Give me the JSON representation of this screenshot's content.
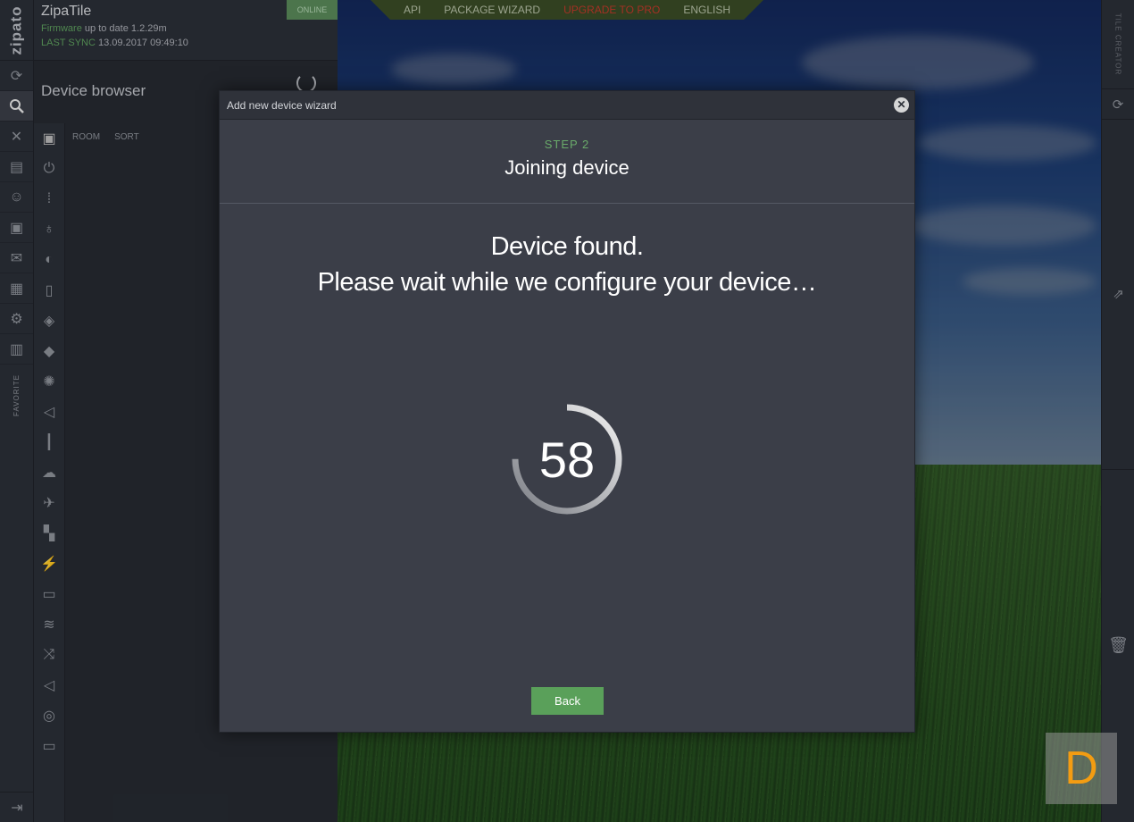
{
  "app": {
    "logo": "zipato",
    "title": "ZipaTile",
    "firmware_label": "Firmware",
    "firmware_text": "up to date 1.2.29m",
    "sync_label": "LAST SYNC",
    "sync_time": "13.09.2017 09:49:10",
    "status": "ONLINE"
  },
  "topnav": {
    "api": "API",
    "package_wizard": "PACKAGE WIZARD",
    "upgrade": "UPGRADE TO PRO",
    "language": "ENGLISH"
  },
  "browser": {
    "title": "Device browser",
    "room": "ROOM",
    "sort": "SORT"
  },
  "rail": {
    "favorite": "FAVORITE"
  },
  "right_rail": {
    "label": "TILE CREATOR"
  },
  "modal": {
    "title": "Add new device wizard",
    "close_glyph": "✕",
    "step_label": "STEP 2",
    "step_title": "Joining device",
    "message_line1": "Device found.",
    "message_line2": "Please wait while we configure your device…",
    "countdown": "58",
    "countdown_progress": 0.75,
    "back_label": "Back"
  },
  "badge": {
    "letter": "D"
  },
  "colors": {
    "accent_green": "#5aa05a",
    "step_green": "#6aaa6a",
    "upgrade_red": "#c0392b",
    "badge_orange": "#f39c12"
  }
}
